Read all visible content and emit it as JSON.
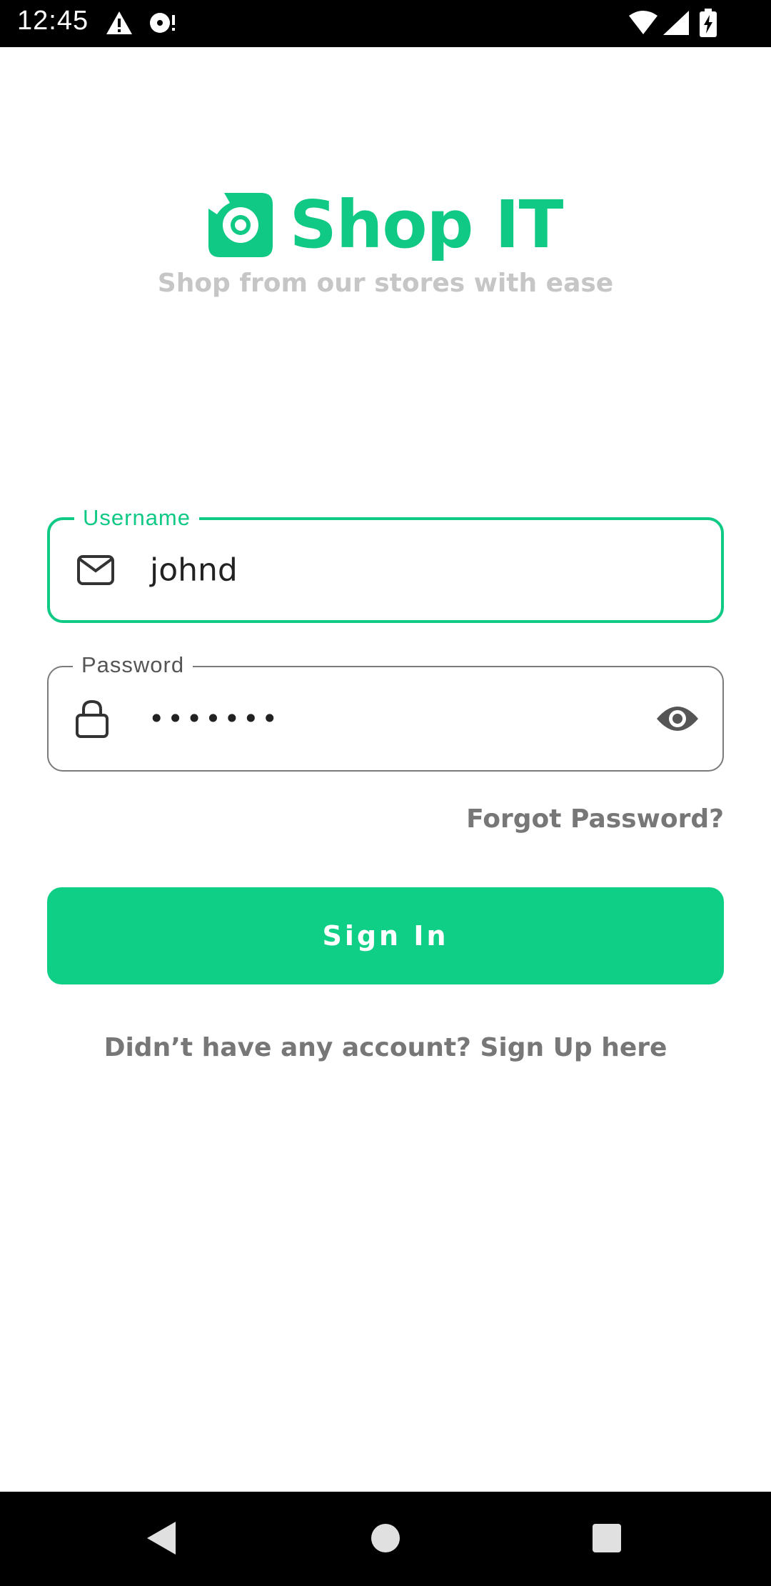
{
  "status_bar": {
    "time": "12:45",
    "icons": [
      "warning-icon",
      "media-icon",
      "wifi-icon",
      "signal-icon",
      "battery-charging-icon"
    ]
  },
  "header": {
    "app_title": "Shop IT",
    "subtitle": "Shop from our stores with ease",
    "logo_icon": "shop-it-logo-icon"
  },
  "form": {
    "username": {
      "label": "Username",
      "value": "johnd",
      "icon": "mail-icon"
    },
    "password": {
      "label": "Password",
      "value": "•••••••",
      "icon": "lock-icon",
      "toggle_icon": "eye-icon"
    },
    "forgot_password": "Forgot Password?",
    "sign_in": "Sign In",
    "sign_up_prompt": "Didn’t have any account? Sign Up here"
  },
  "nav_bar": {
    "icons": [
      "back-icon",
      "home-icon",
      "recents-icon"
    ]
  },
  "colors": {
    "accent": "#10c985",
    "button": "#0fcf86",
    "subtitle": "#c6c6c6",
    "link": "#777777"
  }
}
